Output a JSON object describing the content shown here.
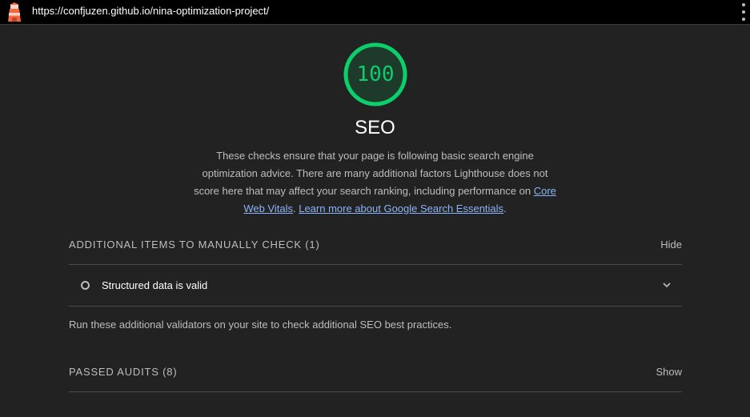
{
  "topbar": {
    "url": "https://confjuzen.github.io/nina-optimization-project/",
    "logo_icon": "lighthouse-icon",
    "menu_icon": "kebab-menu-icon"
  },
  "category": {
    "score": "100",
    "score_fraction": 1.0,
    "score_color": "#0cce6b",
    "title": "SEO",
    "description_prefix": "These checks ensure that your page is following basic search engine optimization advice. There are many additional factors Lighthouse does not score here that may affect your search ranking, including performance on ",
    "link_core_web_vitals": "Core Web Vitals",
    "separator": ". ",
    "link_learn_more": "Learn more about Google Search Essentials",
    "description_suffix": "."
  },
  "manual_group": {
    "title": "ADDITIONAL ITEMS TO MANUALLY CHECK (1)",
    "toggle_label": "Hide",
    "audits": [
      {
        "label": "Structured data is valid",
        "icon": "informative-ring-icon"
      }
    ],
    "note": "Run these additional validators on your site to check additional SEO best practices."
  },
  "passed_group": {
    "title": "PASSED AUDITS (8)",
    "toggle_label": "Show"
  }
}
